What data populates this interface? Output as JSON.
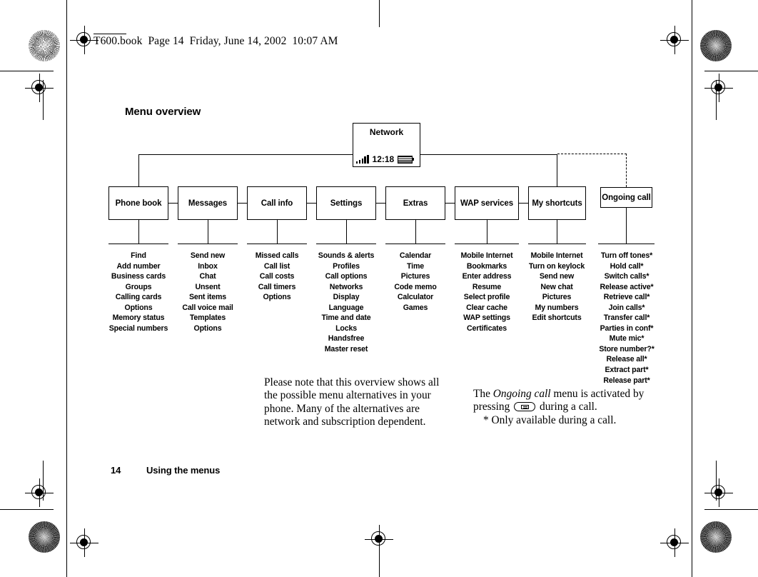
{
  "header": {
    "running_head": "T600.book  Page 14  Friday, June 14, 2002  10:07 AM"
  },
  "section": {
    "title": "Menu overview"
  },
  "phone_screen": {
    "title": "Network",
    "time": "12:18",
    "signal_icon": "signal-bars-icon",
    "battery_icon": "battery-icon"
  },
  "menu": {
    "top_level": [
      {
        "label": "Phone book"
      },
      {
        "label": "Messages"
      },
      {
        "label": "Call info"
      },
      {
        "label": "Settings"
      },
      {
        "label": "Extras"
      },
      {
        "label": "WAP services"
      },
      {
        "label": "My shortcuts"
      },
      {
        "label": "Ongoing call"
      }
    ],
    "submenus": [
      {
        "parent": "Phone book",
        "items": [
          "Find",
          "Add number",
          "Business cards",
          "Groups",
          "Calling cards",
          "Options",
          "Memory status",
          "Special numbers"
        ]
      },
      {
        "parent": "Messages",
        "items": [
          "Send new",
          "Inbox",
          "Chat",
          "Unsent",
          "Sent items",
          "Call voice mail",
          "Templates",
          "Options"
        ]
      },
      {
        "parent": "Call info",
        "items": [
          "Missed calls",
          "Call list",
          "Call costs",
          "Call timers",
          "Options"
        ]
      },
      {
        "parent": "Settings",
        "items": [
          "Sounds & alerts",
          "Profiles",
          "Call options",
          "Networks",
          "Display",
          "Language",
          "Time and date",
          "Locks",
          "Handsfree",
          "Master reset"
        ]
      },
      {
        "parent": "Extras",
        "items": [
          "Calendar",
          "Time",
          "Pictures",
          "Code memo",
          "Calculator",
          "Games"
        ]
      },
      {
        "parent": "WAP services",
        "items": [
          "Mobile Internet",
          "Bookmarks",
          "Enter address",
          "Resume",
          "Select profile",
          "Clear cache",
          "WAP settings",
          "Certificates"
        ]
      },
      {
        "parent": "My shortcuts",
        "items": [
          "Mobile Internet",
          "Turn on keylock",
          "Send new",
          "New chat",
          "Pictures",
          "My numbers",
          "Edit shortcuts"
        ]
      },
      {
        "parent": "Ongoing call",
        "items": [
          "Turn off tones*",
          "Hold call*",
          "Switch calls*",
          "Release active*",
          "Retrieve call*",
          "Join calls*",
          "Transfer call*",
          "Parties in conf*",
          "Mute mic*",
          "Store number?*",
          "Release all*",
          "Extract part*",
          "Release part*"
        ]
      }
    ]
  },
  "notes": {
    "left": "Please note that this overview shows all the possible menu alternatives in your phone. Many of the alternatives are network and subscription dependent.",
    "right_prefix": "The ",
    "right_italic": "Ongoing call",
    "right_middle": " menu is activated by pressing ",
    "right_suffix": " during a call.",
    "footnote": "* Only available during a call."
  },
  "footer": {
    "page_number": "14",
    "chapter": "Using the menus"
  },
  "colors": {
    "ink": "#000000",
    "paper": "#ffffff"
  }
}
